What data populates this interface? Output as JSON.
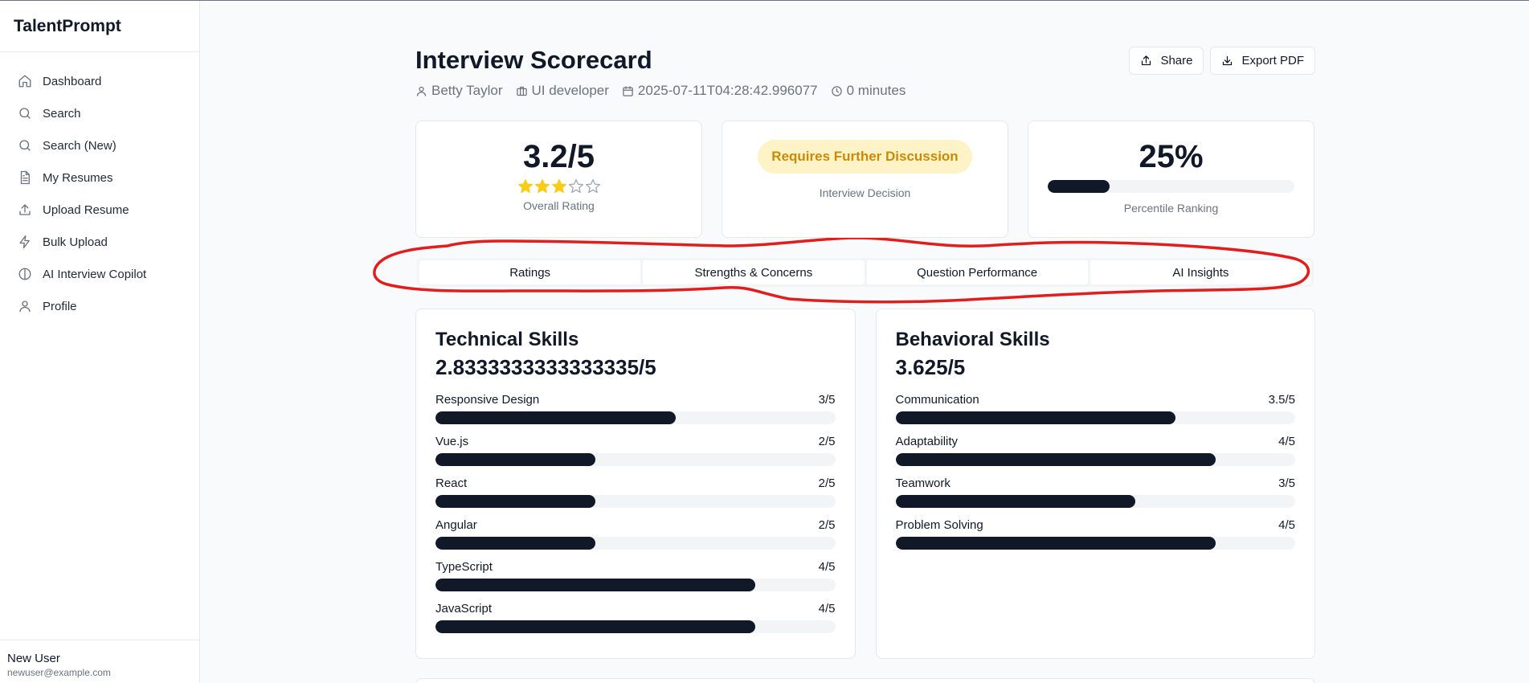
{
  "app": {
    "brand": "TalentPrompt"
  },
  "sidebar": {
    "items": [
      {
        "label": "Dashboard",
        "icon": "home-icon"
      },
      {
        "label": "Search",
        "icon": "search-icon"
      },
      {
        "label": "Search (New)",
        "icon": "search-icon"
      },
      {
        "label": "My Resumes",
        "icon": "document-icon"
      },
      {
        "label": "Upload Resume",
        "icon": "upload-icon"
      },
      {
        "label": "Bulk Upload",
        "icon": "lightning-icon"
      },
      {
        "label": "AI Interview Copilot",
        "icon": "brain-icon"
      },
      {
        "label": "Profile",
        "icon": "user-icon"
      }
    ],
    "user": {
      "name": "New User",
      "email": "newuser@example.com"
    }
  },
  "header": {
    "title": "Interview Scorecard",
    "candidate": "Betty Taylor",
    "role": "UI developer",
    "date": "2025-07-11T04:28:42.996077",
    "duration": "0 minutes",
    "share_label": "Share",
    "export_label": "Export PDF"
  },
  "summary": {
    "overall_rating": "3.2/5",
    "overall_rating_value": 3.2,
    "stars_filled": 3,
    "stars_total": 5,
    "overall_label": "Overall Rating",
    "decision": "Requires Further Discussion",
    "decision_label": "Interview Decision",
    "percentile": "25%",
    "percentile_value": 0.25,
    "percentile_label": "Percentile Ranking"
  },
  "tabs": [
    "Ratings",
    "Strengths & Concerns",
    "Question Performance",
    "AI Insights"
  ],
  "technical": {
    "title": "Technical Skills",
    "score": "2.8333333333333335/5",
    "skills": [
      {
        "name": "Responsive Design",
        "score": "3/5",
        "value": 3
      },
      {
        "name": "Vue.js",
        "score": "2/5",
        "value": 2
      },
      {
        "name": "React",
        "score": "2/5",
        "value": 2
      },
      {
        "name": "Angular",
        "score": "2/5",
        "value": 2
      },
      {
        "name": "TypeScript",
        "score": "4/5",
        "value": 4
      },
      {
        "name": "JavaScript",
        "score": "4/5",
        "value": 4
      }
    ]
  },
  "behavioral": {
    "title": "Behavioral Skills",
    "score": "3.625/5",
    "skills": [
      {
        "name": "Communication",
        "score": "3.5/5",
        "value": 3.5
      },
      {
        "name": "Adaptability",
        "score": "4/5",
        "value": 4
      },
      {
        "name": "Teamwork",
        "score": "3/5",
        "value": 3
      },
      {
        "name": "Problem Solving",
        "score": "4/5",
        "value": 4
      }
    ]
  },
  "colors": {
    "accent_dark": "#111827",
    "star": "#facc15",
    "decision_bg": "#fef3c7",
    "decision_text": "#ca8a04",
    "annotation": "#e11d1d"
  }
}
